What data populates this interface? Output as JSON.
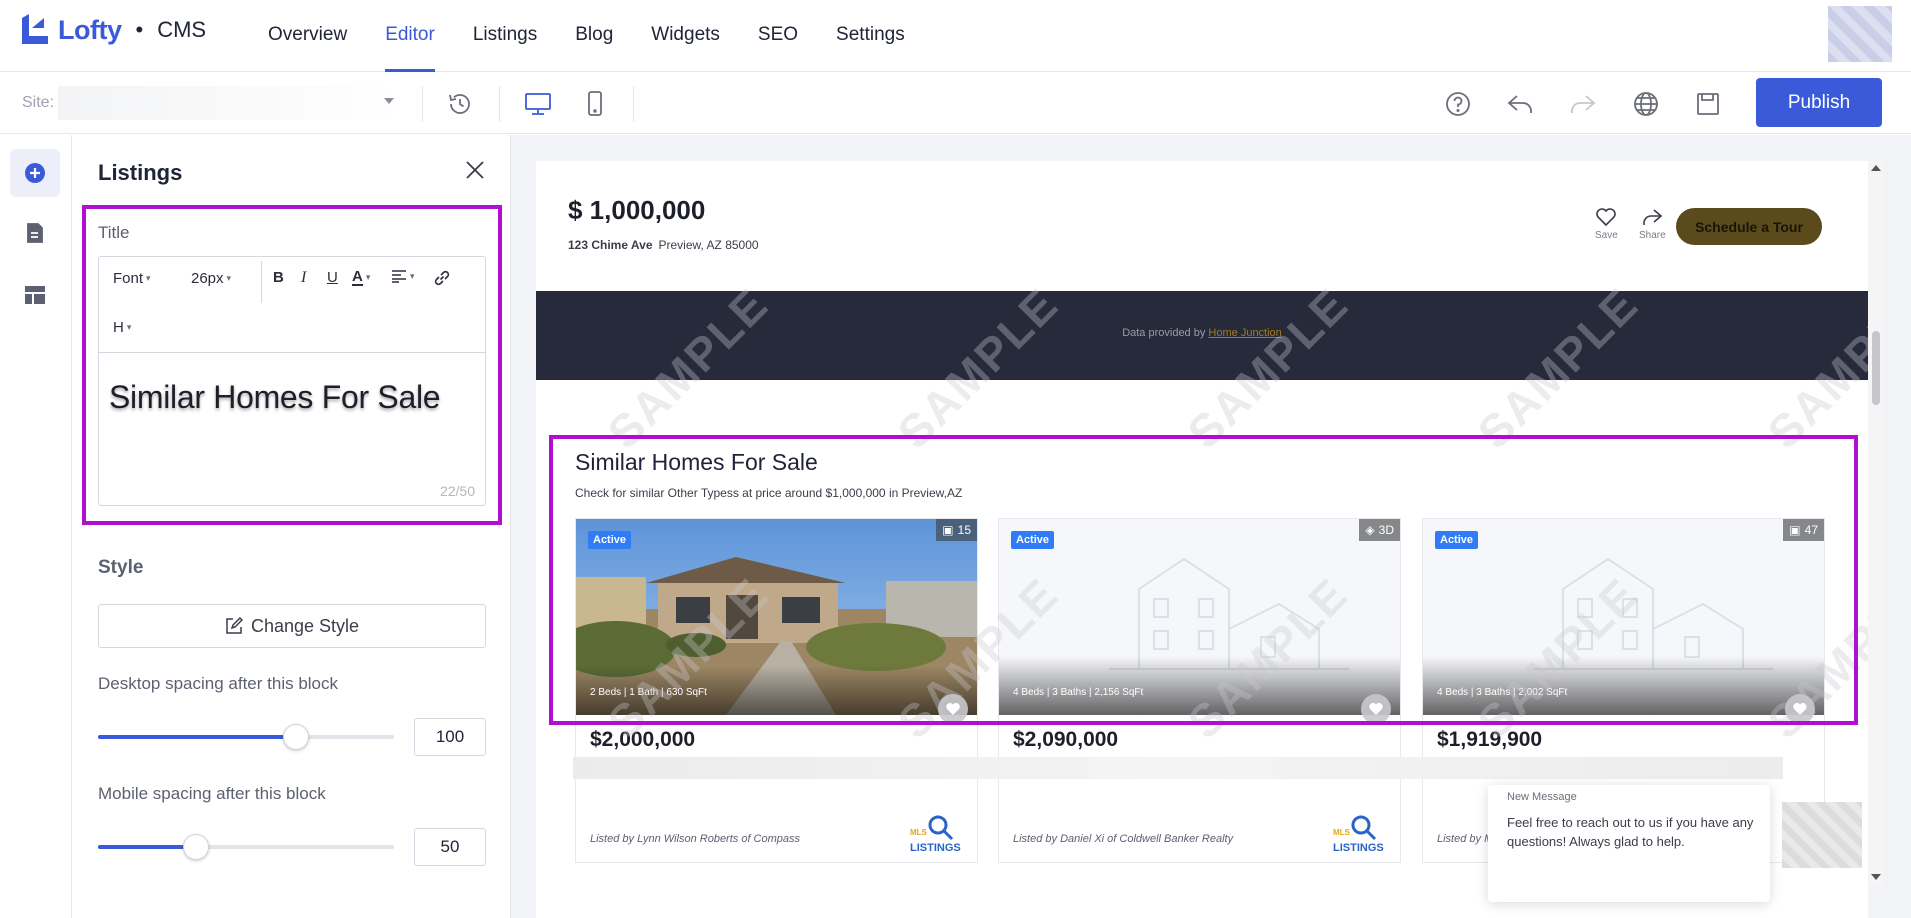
{
  "app": {
    "brand": "Lofty",
    "separator": "•",
    "product": "CMS"
  },
  "nav": {
    "tabs": [
      "Overview",
      "Editor",
      "Listings",
      "Blog",
      "Widgets",
      "SEO",
      "Settings"
    ],
    "active": "Editor"
  },
  "toolbar": {
    "site_label": "Site:",
    "publish_label": "Publish"
  },
  "panel": {
    "title": "Listings",
    "title_field_label": "Title",
    "editor": {
      "font_label": "Font",
      "size_label": "26px",
      "heading_label": "H",
      "text": "Similar Homes For Sale",
      "char_count": "22/50"
    },
    "style_label": "Style",
    "change_style_label": "Change Style",
    "desktop_spacing_label": "Desktop spacing after this block",
    "desktop_spacing_value": "100",
    "desktop_spacing_fraction": 0.67,
    "mobile_spacing_label": "Mobile spacing after this block",
    "mobile_spacing_value": "50",
    "mobile_spacing_fraction": 0.33
  },
  "preview": {
    "price": "$ 1,000,000",
    "address_street": "123 Chime Ave",
    "address_city": "Preview, AZ 85000",
    "save_label": "Save",
    "share_label": "Share",
    "tour_label": "Schedule a Tour",
    "provided_text": "Data provided by",
    "provided_link": "Home Junction",
    "similar_title": "Similar Homes For Sale",
    "similar_subtitle": "Check for similar Other Typess at price around $1,000,000 in Preview,AZ",
    "watermark": "SAMPLE",
    "cards": [
      {
        "badge": "Active",
        "media": "15",
        "specs": "2 Beds   |   1 Bath   |   630 SqFt",
        "price": "$2,000,000",
        "listed": "Listed by Lynn Wilson Roberts of Compass",
        "photo": "house-photo"
      },
      {
        "badge": "Active",
        "media": "3D",
        "specs": "4 Beds   |   3 Baths   |   2,156 SqFt",
        "price": "$2,090,000",
        "listed": "Listed by Daniel Xi of Coldwell Banker Realty",
        "photo": "placeholder"
      },
      {
        "badge": "Active",
        "media": "47",
        "specs": "4 Beds   |   3 Baths   |   2,002 SqFt",
        "price": "$1,919,900",
        "listed": "Listed by M",
        "photo": "placeholder"
      }
    ],
    "mls_logo_text": [
      "MLS",
      "LISTINGS"
    ]
  },
  "chat": {
    "header": "New Message",
    "body": "Feel free to reach out to us if you have any questions! Always glad to help."
  },
  "colors": {
    "accent": "#3a5ad9",
    "highlight": "#b10fcf",
    "tour_button": "#5a4a1c",
    "badge": "#2f7cf6"
  }
}
